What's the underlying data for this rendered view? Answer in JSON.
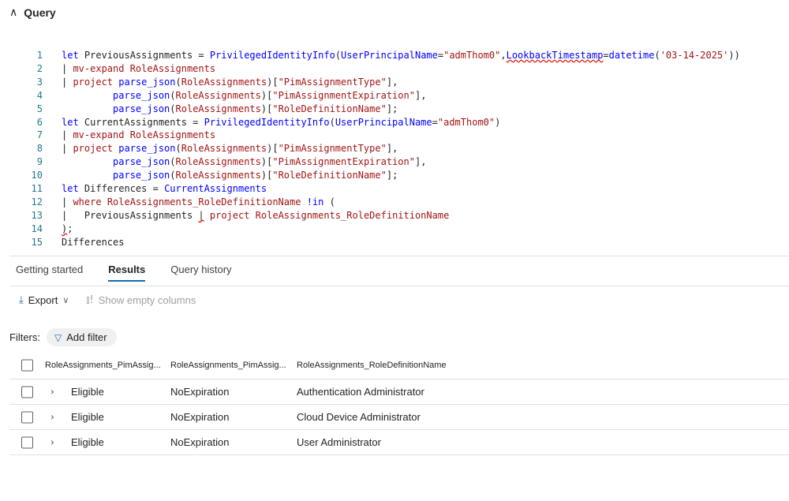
{
  "query_section": {
    "title": "Query"
  },
  "editor": {
    "lines": [
      {
        "num": "1",
        "tokens": [
          {
            "t": "let ",
            "c": "k"
          },
          {
            "t": "PreviousAssignments = ",
            "c": "plain"
          },
          {
            "t": "PrivilegedIdentityInfo",
            "c": "f"
          },
          {
            "t": "(",
            "c": "p"
          },
          {
            "t": "UserPrincipalName",
            "c": "f"
          },
          {
            "t": "=",
            "c": "p"
          },
          {
            "t": "\"admThom0\"",
            "c": "s"
          },
          {
            "t": ",",
            "c": "p"
          },
          {
            "t": "LookbackTimestamp",
            "c": "f squig"
          },
          {
            "t": "=",
            "c": "p"
          },
          {
            "t": "datetime",
            "c": "f"
          },
          {
            "t": "(",
            "c": "p"
          },
          {
            "t": "'03-14-2025'",
            "c": "s"
          },
          {
            "t": "))",
            "c": "p"
          }
        ]
      },
      {
        "num": "2",
        "tokens": [
          {
            "t": "| ",
            "c": "pipe"
          },
          {
            "t": "mv-expand ",
            "c": "t"
          },
          {
            "t": "RoleAssignments",
            "c": "t"
          }
        ]
      },
      {
        "num": "3",
        "tokens": [
          {
            "t": "| ",
            "c": "pipe"
          },
          {
            "t": "project ",
            "c": "t"
          },
          {
            "t": "parse_json",
            "c": "f"
          },
          {
            "t": "(",
            "c": "p"
          },
          {
            "t": "RoleAssignments",
            "c": "t"
          },
          {
            "t": ")[",
            "c": "p"
          },
          {
            "t": "\"PimAssignmentType\"",
            "c": "s"
          },
          {
            "t": "],",
            "c": "p"
          }
        ]
      },
      {
        "num": "4",
        "tokens": [
          {
            "t": "         ",
            "c": "plain"
          },
          {
            "t": "parse_json",
            "c": "f"
          },
          {
            "t": "(",
            "c": "p"
          },
          {
            "t": "RoleAssignments",
            "c": "t"
          },
          {
            "t": ")[",
            "c": "p"
          },
          {
            "t": "\"PimAssignmentExpiration\"",
            "c": "s"
          },
          {
            "t": "],",
            "c": "p"
          }
        ]
      },
      {
        "num": "5",
        "tokens": [
          {
            "t": "         ",
            "c": "plain"
          },
          {
            "t": "parse_json",
            "c": "f"
          },
          {
            "t": "(",
            "c": "p"
          },
          {
            "t": "RoleAssignments",
            "c": "t"
          },
          {
            "t": ")[",
            "c": "p"
          },
          {
            "t": "\"RoleDefinitionName\"",
            "c": "s"
          },
          {
            "t": "];",
            "c": "p"
          }
        ]
      },
      {
        "num": "6",
        "tokens": [
          {
            "t": "let ",
            "c": "k"
          },
          {
            "t": "CurrentAssignments = ",
            "c": "plain"
          },
          {
            "t": "PrivilegedIdentityInfo",
            "c": "f"
          },
          {
            "t": "(",
            "c": "p"
          },
          {
            "t": "UserPrincipalName",
            "c": "f"
          },
          {
            "t": "=",
            "c": "p"
          },
          {
            "t": "\"admThom0\"",
            "c": "s"
          },
          {
            "t": ")",
            "c": "p"
          }
        ]
      },
      {
        "num": "7",
        "tokens": [
          {
            "t": "| ",
            "c": "pipe"
          },
          {
            "t": "mv-expand ",
            "c": "t"
          },
          {
            "t": "RoleAssignments",
            "c": "t"
          }
        ]
      },
      {
        "num": "8",
        "tokens": [
          {
            "t": "| ",
            "c": "pipe"
          },
          {
            "t": "project ",
            "c": "t"
          },
          {
            "t": "parse_json",
            "c": "f"
          },
          {
            "t": "(",
            "c": "p"
          },
          {
            "t": "RoleAssignments",
            "c": "t"
          },
          {
            "t": ")[",
            "c": "p"
          },
          {
            "t": "\"PimAssignmentType\"",
            "c": "s"
          },
          {
            "t": "],",
            "c": "p"
          }
        ]
      },
      {
        "num": "9",
        "tokens": [
          {
            "t": "         ",
            "c": "plain"
          },
          {
            "t": "parse_json",
            "c": "f"
          },
          {
            "t": "(",
            "c": "p"
          },
          {
            "t": "RoleAssignments",
            "c": "t"
          },
          {
            "t": ")[",
            "c": "p"
          },
          {
            "t": "\"PimAssignmentExpiration\"",
            "c": "s"
          },
          {
            "t": "],",
            "c": "p"
          }
        ]
      },
      {
        "num": "10",
        "tokens": [
          {
            "t": "         ",
            "c": "plain"
          },
          {
            "t": "parse_json",
            "c": "f"
          },
          {
            "t": "(",
            "c": "p"
          },
          {
            "t": "RoleAssignments",
            "c": "t"
          },
          {
            "t": ")[",
            "c": "p"
          },
          {
            "t": "\"RoleDefinitionName\"",
            "c": "s"
          },
          {
            "t": "];",
            "c": "p"
          }
        ]
      },
      {
        "num": "11",
        "tokens": [
          {
            "t": "let ",
            "c": "k"
          },
          {
            "t": "Differences = ",
            "c": "plain"
          },
          {
            "t": "CurrentAssignments",
            "c": "f"
          }
        ]
      },
      {
        "num": "12",
        "tokens": [
          {
            "t": "| ",
            "c": "pipe"
          },
          {
            "t": "where ",
            "c": "t"
          },
          {
            "t": "RoleAssignments_RoleDefinitionName ",
            "c": "t"
          },
          {
            "t": "!in ",
            "c": "k"
          },
          {
            "t": "(",
            "c": "p"
          }
        ]
      },
      {
        "num": "13",
        "tokens": [
          {
            "t": "|   ",
            "c": "pipe"
          },
          {
            "t": "PreviousAssignments ",
            "c": "plain"
          },
          {
            "t": "|",
            "c": "pipe squig"
          },
          {
            "t": " project ",
            "c": "t"
          },
          {
            "t": "RoleAssignments_RoleDefinitionName",
            "c": "t"
          }
        ]
      },
      {
        "num": "14",
        "tokens": [
          {
            "t": ")",
            "c": "p squig"
          },
          {
            "t": ";",
            "c": "p"
          }
        ]
      },
      {
        "num": "15",
        "tokens": [
          {
            "t": "Differences",
            "c": "plain"
          }
        ]
      }
    ]
  },
  "tabs": [
    {
      "label": "Getting started",
      "active": false
    },
    {
      "label": "Results",
      "active": true
    },
    {
      "label": "Query history",
      "active": false
    }
  ],
  "toolbar": {
    "export_label": "Export",
    "show_empty_label": "Show empty columns"
  },
  "filters": {
    "label": "Filters:",
    "add_filter_label": "Add filter"
  },
  "results_table": {
    "columns": [
      "RoleAssignments_PimAssig...",
      "RoleAssignments_PimAssig...",
      "RoleAssignments_RoleDefinitionName"
    ],
    "rows": [
      [
        "Eligible",
        "NoExpiration",
        "Authentication Administrator"
      ],
      [
        "Eligible",
        "NoExpiration",
        "Cloud Device Administrator"
      ],
      [
        "Eligible",
        "NoExpiration",
        "User Administrator"
      ]
    ]
  },
  "colors": {
    "accent": "#0f6cbd",
    "keyword": "#0000ff",
    "table_name": "#a31515",
    "line_number": "#237893"
  }
}
